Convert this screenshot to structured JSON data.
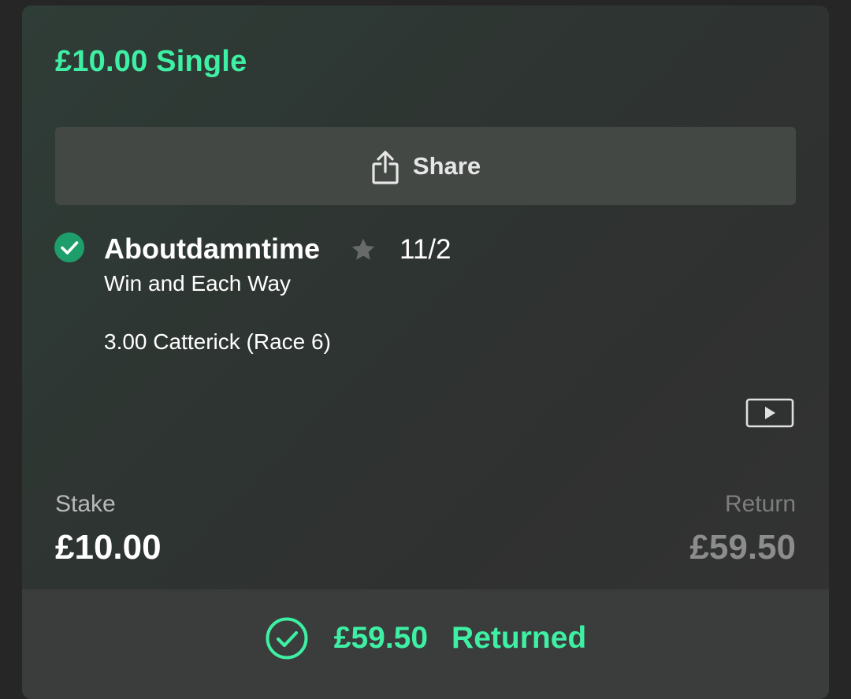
{
  "bet": {
    "title": "£10.00 Single"
  },
  "share": {
    "label": "Share",
    "icon": "share-icon"
  },
  "selection": {
    "status_icon": "check-circle-icon",
    "name": "Aboutdamntime",
    "favourite_icon": "star-icon",
    "odds": "11/2",
    "market": "Win and Each Way",
    "event": "3.00 Catterick (Race 6)"
  },
  "video": {
    "icon": "play-video-icon"
  },
  "summary": {
    "stake_label": "Stake",
    "stake_value": "£10.00",
    "return_label": "Return",
    "return_value": "£59.50"
  },
  "result": {
    "icon": "check-circle-outline-icon",
    "amount": "£59.50",
    "status": "Returned"
  },
  "colors": {
    "accent": "#3ef0a4",
    "card_bg": "#2f3532",
    "button_bg": "#434845",
    "check_fill": "#1e9e6a",
    "muted": "#8c8c8c"
  }
}
